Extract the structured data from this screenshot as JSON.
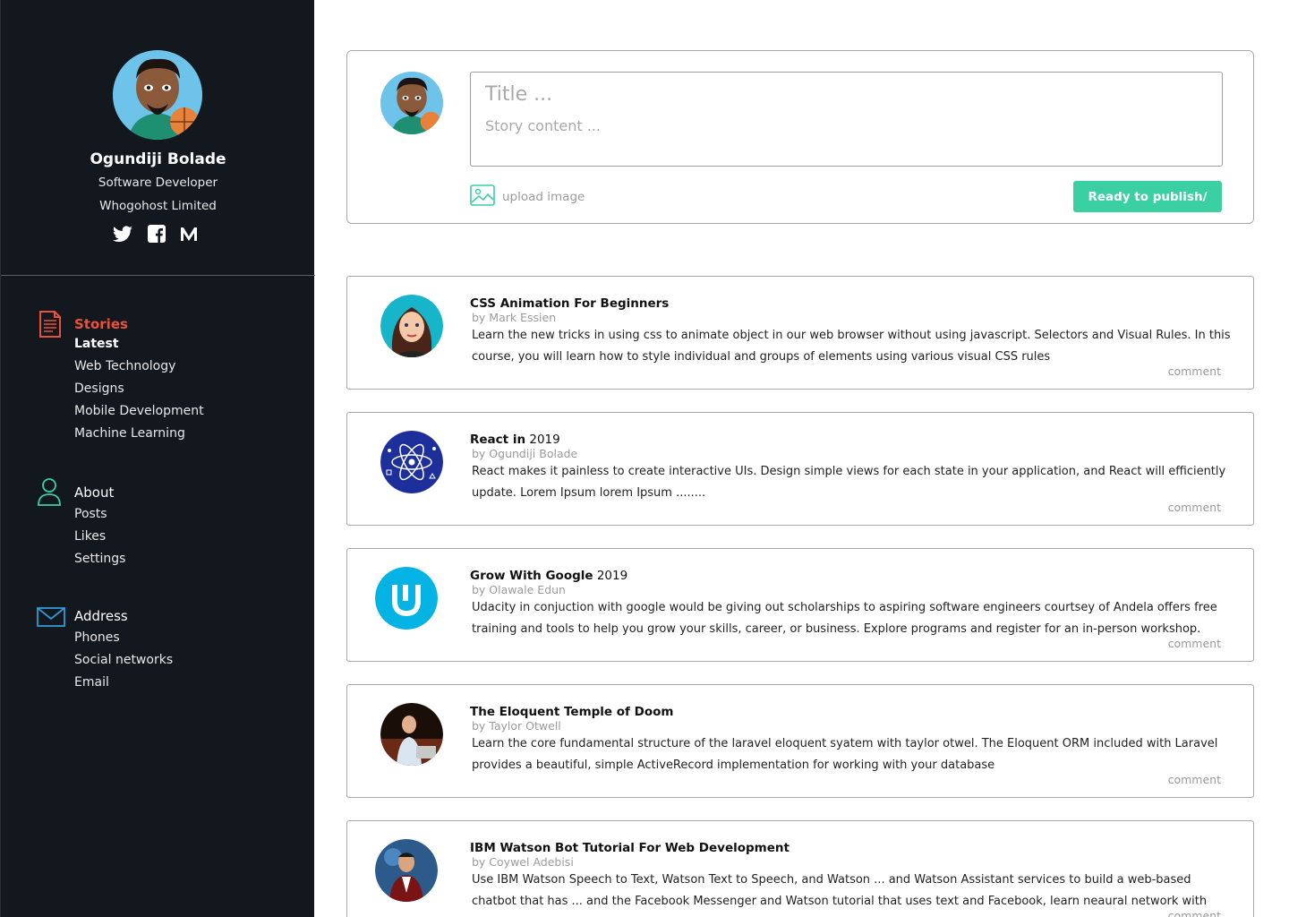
{
  "profile": {
    "name": "Ogundiji Bolade",
    "role": "Software Developer",
    "company": "Whogohost Limited",
    "socials": [
      "twitter-icon",
      "facebook-icon",
      "medium-icon"
    ]
  },
  "nav": {
    "stories": {
      "label": "Stories",
      "items": [
        "Latest",
        "Web Technology",
        "Designs",
        "Mobile Development",
        "Machine Learning"
      ]
    },
    "about": {
      "label": "About",
      "items": [
        "Posts",
        "Likes",
        "Settings"
      ]
    },
    "address": {
      "label": "Address",
      "items": [
        "Phones",
        "Social networks",
        "Email"
      ]
    }
  },
  "composer": {
    "title_placeholder": "Title ...",
    "content_placeholder": "Story content ...",
    "upload_label": "upload image",
    "publish_label": "Ready to publish/"
  },
  "colors": {
    "sidebar_bg": "#13181e",
    "accent_red": "#e9513c",
    "accent_green": "#3ad0a2",
    "about_icon": "#3ad0a2",
    "address_icon": "#2f9bd6"
  },
  "stories": [
    {
      "title_bold": "CSS Animation For Beginners",
      "title_rest": "",
      "author": "by Mark Essien",
      "body": "Learn the new tricks in using css to animate object in our web browser without using javascript. Selectors and Visual Rules. In this course, you will learn how to style individual and groups of elements using various visual CSS rules",
      "comment": "comment"
    },
    {
      "title_bold": "React in",
      "title_rest": " 2019",
      "author": "by Ogundiji Bolade",
      "body": "React makes it painless to create interactive UIs. Design simple views for each state in your application, and React will efficiently update. Lorem Ipsum lorem Ipsum ........",
      "comment": "comment"
    },
    {
      "title_bold": "Grow With Google",
      "title_rest": " 2019",
      "author": "by Olawale Edun",
      "body": "Udacity in conjuction with google would be giving out scholarships to aspiring software engineers courtsey of Andela  offers free training and tools to help you grow your skills, career, or business. Explore programs and register for an in-person workshop.",
      "comment": "comment"
    },
    {
      "title_bold": "The Eloquent Temple of Doom",
      "title_rest": "",
      "author": "by Taylor Otwell",
      "body": "Learn the core fundamental structure of the laravel eloquent syatem with taylor otwel. The Eloquent ORM included with Laravel provides a beautiful, simple ActiveRecord implementation for working with your database",
      "comment": "comment"
    },
    {
      "title_bold": "IBM Watson Bot Tutorial For Web Development",
      "title_rest": "",
      "author": "by Coywel Adebisi",
      "body": "Use IBM Watson Speech to Text, Watson Text to Speech, and Watson ... and Watson Assistant services to build a web-based chatbot that has ... and the Facebook Messenger and Watson tutorial that uses text and Facebook, learn neaural network with tanmay. Lorem Ipsum",
      "comment": "comment"
    }
  ]
}
